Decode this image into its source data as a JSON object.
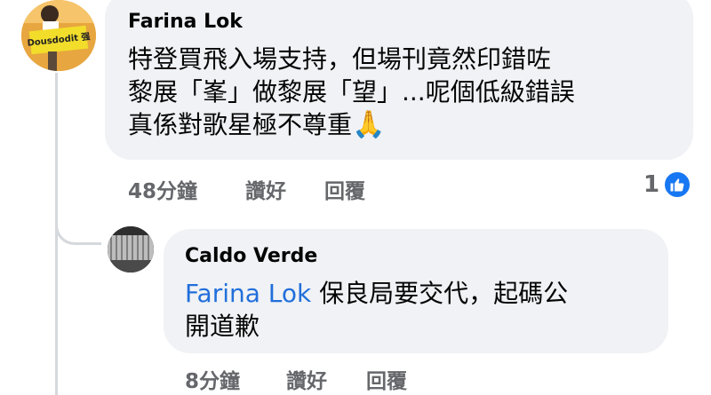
{
  "comments": [
    {
      "author": "Farina Lok",
      "avatar_text": "Dousdodit 强",
      "text_lines": [
        "特登買飛入場支持，但場刊竟然印錯咗",
        "黎展「峯」做黎展「望」...呢個低級錯誤",
        "真係對歌星極不尊重"
      ],
      "emoji": "🙏",
      "time": "48分鐘",
      "like_label": "讚好",
      "reply_label": "回覆",
      "reaction_count": "1",
      "reaction_icon": "like-icon"
    },
    {
      "author": "Caldo Verde",
      "mention": "Farina Lok",
      "text_first": " 保良局要交代，起碼公",
      "text_second": "開道歉",
      "time": "8分鐘",
      "like_label": "讚好",
      "reply_label": "回覆"
    }
  ],
  "colors": {
    "bubble": "#f0f2f5",
    "meta": "#65676b",
    "mention": "#216fdb",
    "like_badge": "#1877f2"
  }
}
